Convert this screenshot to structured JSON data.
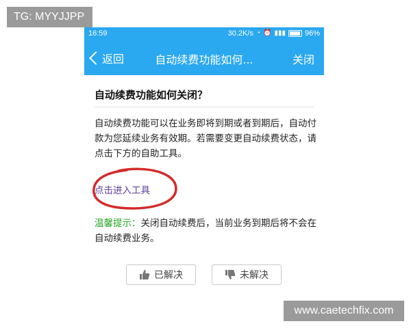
{
  "overlay": {
    "tg_text": "TG: MYYJJPP",
    "watermark_text": "www.caetechfix.com"
  },
  "status_bar": {
    "time": "16:59",
    "speed": "30.2K/s",
    "battery": "96%"
  },
  "nav": {
    "back_label": "返回",
    "title": "自动续费功能如何...",
    "close_label": "关闭"
  },
  "article": {
    "question": "自动续费功能如何关闭？",
    "body": "自动续费功能可以在业务即将到期或者到期后，自动付款为您延续业务有效期。若需要变更自动续费状态，请点击下方的自助工具。",
    "tool_link": "点击进入工具",
    "tip_label": "温馨提示：",
    "tip_text": "关闭自动续费后，当前业务到期后将不会在自动续费业务。"
  },
  "feedback": {
    "solved_label": "已解决",
    "unsolved_label": "未解决"
  },
  "colors": {
    "brand": "#2aa8f0",
    "tip_green": "#28a428",
    "annotation_red": "#d42a2a"
  }
}
